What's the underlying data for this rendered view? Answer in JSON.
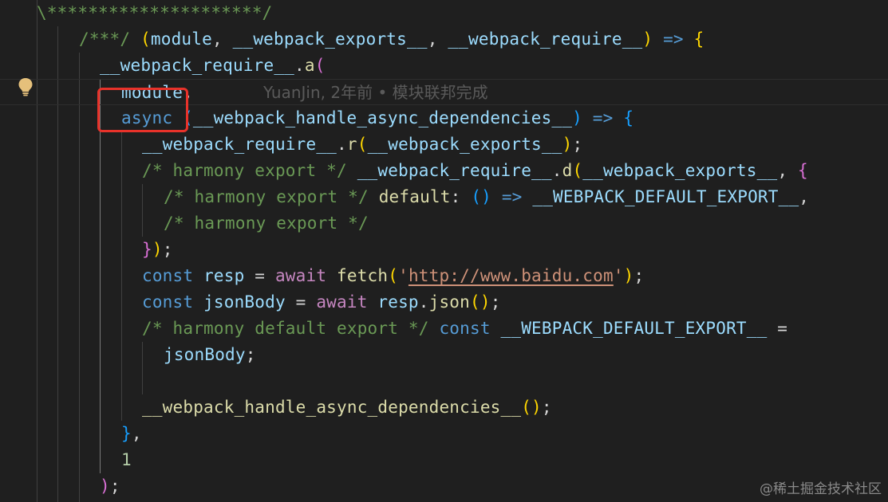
{
  "editor": {
    "blame": "YuanJin, 2年前 • 模块联邦完成",
    "watermark": "@稀土掘金技术社区"
  },
  "code": {
    "l0": {
      "t0": "\\*********************/"
    },
    "l1": {
      "t0": "/***/",
      "t1": " ",
      "t2": "(",
      "t3": "module",
      "t4": ", ",
      "t5": "__webpack_exports__",
      "t6": ", ",
      "t7": "__webpack_require__",
      "t8": ")",
      "t9": " => ",
      "t10": "{"
    },
    "l2": {
      "t0": "__webpack_require__",
      "t1": ".",
      "t2": "a",
      "t3": "("
    },
    "l3": {
      "t0": "module",
      "t1": ","
    },
    "l4": {
      "t0": "async",
      "t1": " ",
      "t2": "(",
      "t3": "__webpack_handle_async_dependencies__",
      "t4": ")",
      "t5": " => ",
      "t6": "{"
    },
    "l5": {
      "t0": "__webpack_require__",
      "t1": ".",
      "t2": "r",
      "t3": "(",
      "t4": "__webpack_exports__",
      "t5": ")",
      "t6": ";"
    },
    "l6": {
      "t0": "/* harmony export */",
      "t1": " ",
      "t2": "__webpack_require__",
      "t3": ".",
      "t4": "d",
      "t5": "(",
      "t6": "__webpack_exports__",
      "t7": ", ",
      "t8": "{"
    },
    "l7": {
      "t0": "/* harmony export */",
      "t1": " ",
      "t2": "default",
      "t3": ": ",
      "t4": "()",
      "t5": " => ",
      "t6": "__WEBPACK_DEFAULT_EXPORT__",
      "t7": ","
    },
    "l8": {
      "t0": "/* harmony export */"
    },
    "l9": {
      "t0": "}",
      "t1": ")",
      "t2": ";"
    },
    "l10": {
      "t0": "const",
      "t1": " ",
      "t2": "resp",
      "t3": " = ",
      "t4": "await",
      "t5": " ",
      "t6": "fetch",
      "t7": "(",
      "t8": "'",
      "t9": "http://www.baidu.com",
      "t10": "'",
      "t11": ")",
      "t12": ";"
    },
    "l11": {
      "t0": "const",
      "t1": " ",
      "t2": "jsonBody",
      "t3": " = ",
      "t4": "await",
      "t5": " ",
      "t6": "resp",
      "t7": ".",
      "t8": "json",
      "t9": "()",
      "t10": ";"
    },
    "l12": {
      "t0": "/* harmony default export */",
      "t1": " ",
      "t2": "const",
      "t3": " ",
      "t4": "__WEBPACK_DEFAULT_EXPORT__",
      "t5": " ="
    },
    "l13": {
      "t0": "jsonBody",
      "t1": ";"
    },
    "l14": {},
    "l15": {
      "t0": "__webpack_handle_async_dependencies__",
      "t1": "()",
      "t2": ";"
    },
    "l16": {
      "t0": "}",
      "t1": ","
    },
    "l17": {
      "t0": "1"
    },
    "l18": {
      "t0": ")",
      "t1": ";"
    }
  },
  "colors": {
    "highlight_box": "#e8322a",
    "bulb": "#e5c07b"
  },
  "icons": {
    "bulb": "lightbulb-icon"
  }
}
